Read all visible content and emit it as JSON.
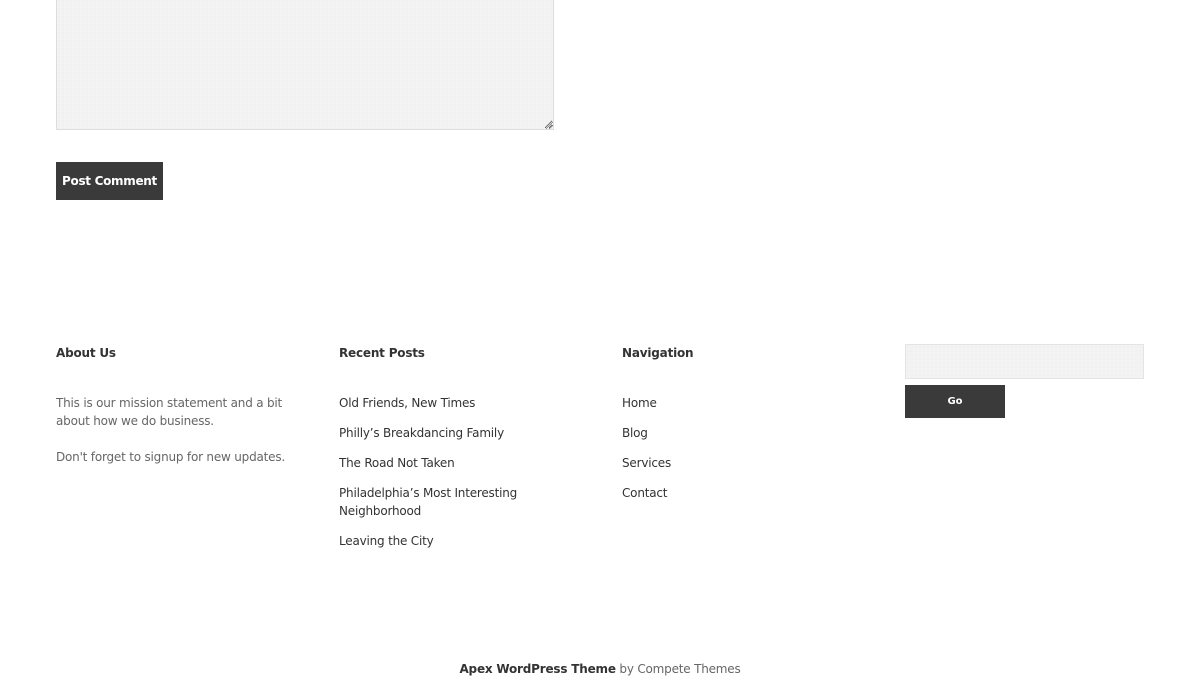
{
  "comment_form": {
    "textarea_value": "",
    "submit_label": "Post Comment"
  },
  "footer": {
    "about": {
      "title": "About Us",
      "paragraphs": [
        "This is our mission statement and a bit about how we do business.",
        "Don't forget to signup for new updates."
      ]
    },
    "recent_posts": {
      "title": "Recent Posts",
      "items": [
        "Old Friends, New Times",
        "Philly’s Breakdancing Family",
        "The Road Not Taken",
        "Philadelphia’s Most Interesting Neighborhood",
        "Leaving the City"
      ]
    },
    "navigation": {
      "title": "Navigation",
      "items": [
        "Home",
        "Blog",
        "Services",
        "Contact"
      ]
    },
    "search": {
      "input_value": "",
      "button_label": "Go"
    }
  },
  "credit": {
    "theme_link": "Apex WordPress Theme",
    "by_text": " by ",
    "author_link": "Compete Themes"
  },
  "colors": {
    "button_bg": "#3a3a3a",
    "button_text": "#ffffff",
    "heading_text": "#333333",
    "body_text": "#666666",
    "field_bg": "#f3f3f3"
  }
}
